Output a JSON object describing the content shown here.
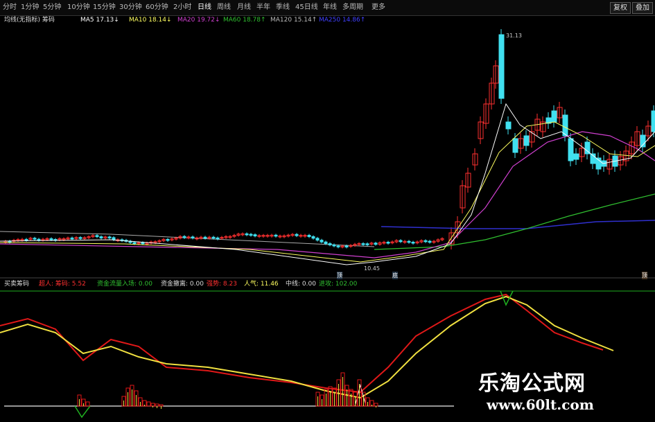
{
  "toolbar": {
    "tabs": [
      "分时",
      "1分钟",
      "5分钟",
      "10分钟",
      "15分钟",
      "30分钟",
      "60分钟",
      "2小时",
      "日线",
      "周线",
      "月线",
      "半年",
      "季线",
      "45日线",
      "年线",
      "多周期",
      "更多"
    ],
    "active_tab": "日线",
    "right_buttons": [
      "复权",
      "叠加"
    ]
  },
  "ma_bar": {
    "title": "均线(无指标) 筹码",
    "ma5": "MA5 17.13↓",
    "ma10": "MA10 18.14↓",
    "ma20": "MA20 19.72↓",
    "ma60": "MA60 18.78↑",
    "ma120": "MA120 15.14↑",
    "ma250": "MA250 14.86↑"
  },
  "price_labels": {
    "high": "31.13",
    "low": "10.45"
  },
  "markers": {
    "marker1": "顶",
    "marker2": "底",
    "marker3": "顶"
  },
  "indicator_bar": {
    "name": "买卖筹码",
    "item1": "超人: 筹码: 5.52",
    "item2": "资金流量入场: 0.00",
    "item3": "资金撤离: 0.00",
    "item4": "强势: 8.23",
    "item5": "人气: 11.46",
    "item6": "中线: 0.00",
    "item7": "进攻: 102.00"
  },
  "watermark": {
    "title": "乐淘公式网",
    "url": "www.60lt.com"
  },
  "colors": {
    "up": "#ff3030",
    "down": "#40e0f0",
    "ma5": "#ffffff",
    "ma10": "#ffff60",
    "ma20": "#d040d0",
    "ma60": "#30c030",
    "ma120": "#3030d0",
    "ind_red": "#e01818",
    "ind_yellow": "#f0e040",
    "ind_green": "#20b020"
  }
}
